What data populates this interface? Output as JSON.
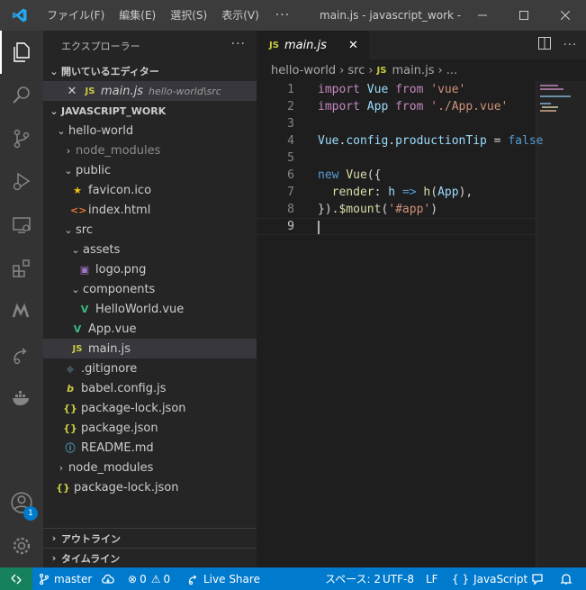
{
  "titlebar": {
    "menus": [
      "ファイル(F)",
      "編集(E)",
      "選択(S)",
      "表示(V)"
    ],
    "more": "···",
    "title": "main.js - javascript_work - ..."
  },
  "activity": {
    "accounts_badge": "1"
  },
  "sidebar": {
    "title": "エクスプローラー",
    "more": "···",
    "open_editors": {
      "label": "開いているエディター",
      "file": "main.js",
      "path": "hello-world\\src"
    },
    "workspace": "JAVASCRIPT_WORK",
    "tree": {
      "hello_world": "hello-world",
      "node_modules": "node_modules",
      "public": "public",
      "favicon": "favicon.ico",
      "index_html": "index.html",
      "src": "src",
      "assets": "assets",
      "logo": "logo.png",
      "components": "components",
      "helloworld_vue": "HelloWorld.vue",
      "app_vue": "App.vue",
      "main_js": "main.js",
      "gitignore": ".gitignore",
      "babel": "babel.config.js",
      "package_lock": "package-lock.json",
      "package_json": "package.json",
      "readme": "README.md",
      "root_node_modules": "node_modules",
      "root_package_lock": "package-lock.json"
    },
    "outline": "アウトライン",
    "timeline": "タイムライン"
  },
  "editor": {
    "tab": "main.js",
    "tab_icon": "JS",
    "breadcrumb": {
      "folder1": "hello-world",
      "folder2": "src",
      "file": "main.js",
      "more": "..."
    },
    "lines": [
      "1",
      "2",
      "3",
      "4",
      "5",
      "6",
      "7",
      "8",
      "9"
    ]
  },
  "statusbar": {
    "branch": "master",
    "errors": "0",
    "warnings": "0",
    "liveshare": "Live Share",
    "spaces": "スペース: 2",
    "encoding": "UTF-8",
    "eol": "LF",
    "language": "JavaScript"
  },
  "colors": {
    "activity_bar": "#333333",
    "sidebar": "#252526",
    "editor": "#1e1e1e",
    "statusbar": "#007acc",
    "remote": "#16825d",
    "vscode_blue": "#23a9f2"
  }
}
